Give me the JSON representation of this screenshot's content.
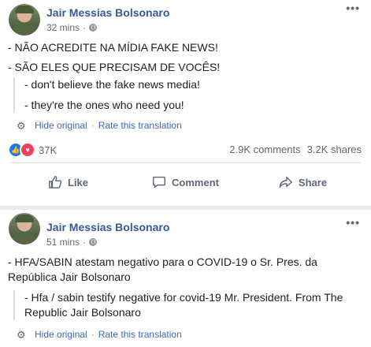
{
  "posts": [
    {
      "author": "Jair Messias Bolsonaro",
      "time": "32 mins",
      "original_lines": [
        "- NÃO ACREDITE NA MÍDIA FAKE NEWS!",
        "- SÃO ELES QUE PRECISAM DE VOCÊS!"
      ],
      "translation_lines": [
        "- don't believe the fake news media!",
        "- they're the ones who need you!"
      ],
      "hide_original": "Hide original",
      "rate_translation": "Rate this translation",
      "reaction_count": "37K",
      "comments": "2.9K comments",
      "shares": "3.2K shares",
      "actions": {
        "like": "Like",
        "comment": "Comment",
        "share": "Share"
      }
    },
    {
      "author": "Jair Messias Bolsonaro",
      "time": "51 mins",
      "original_text": "- HFA/SABIN atestam negativo para o COVID-19 o Sr. Pres. da República Jair Bolsonaro",
      "translation_text": "- Hfa / sabin testify negative for covid-19 Mr. President. From The Republic Jair Bolsonaro",
      "hide_original": "Hide original",
      "rate_translation": "Rate this translation"
    }
  ],
  "icons": {
    "more": "more-options-icon",
    "privacy": "globe-icon",
    "settings": "gear-icon",
    "like": "thumbs-up-icon",
    "comment": "speech-bubble-icon",
    "share": "share-arrow-icon"
  },
  "colors": {
    "author_link": "#385898",
    "translation_link": "#4267b2",
    "like_reaction": "#1877f2",
    "love_reaction": "#f33e58"
  }
}
